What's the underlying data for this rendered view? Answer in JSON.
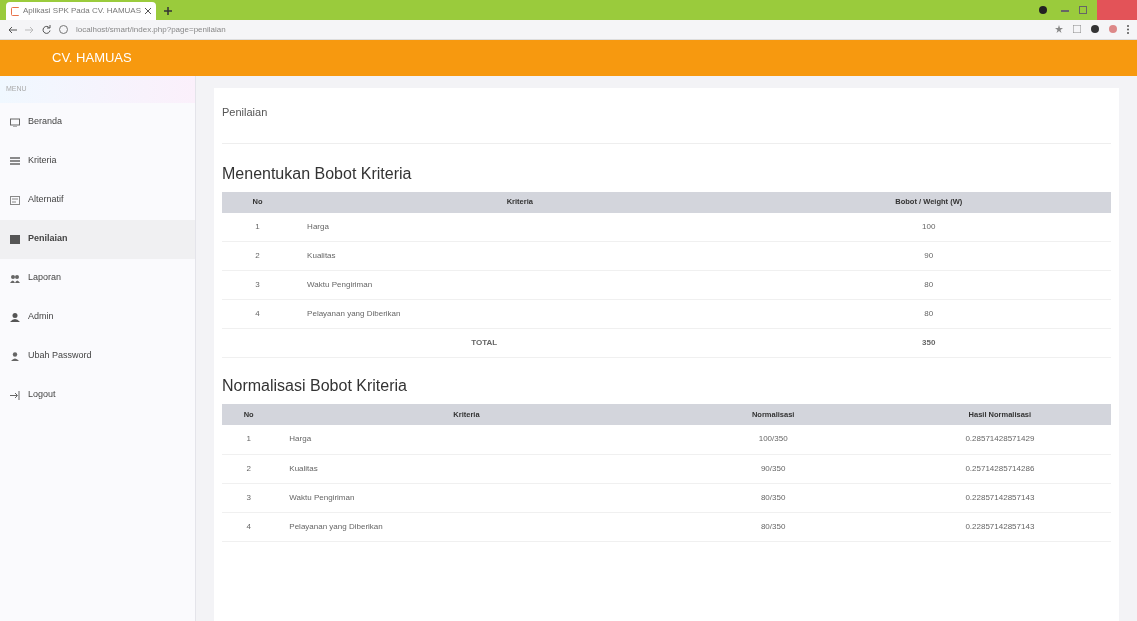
{
  "browser": {
    "tab_title": "Aplikasi SPK Pada CV. HAMUAS",
    "url": "localhost/smart/index.php?page=penilaian"
  },
  "header": {
    "brand": "CV. HAMUAS"
  },
  "sidebar": {
    "heading": "MENU",
    "items": [
      {
        "label": "Beranda",
        "selected": false
      },
      {
        "label": "Kriteria",
        "selected": false
      },
      {
        "label": "Alternatif",
        "selected": false
      },
      {
        "label": "Penilaian",
        "selected": true
      },
      {
        "label": "Laporan",
        "selected": false
      },
      {
        "label": "Admin",
        "selected": false
      },
      {
        "label": "Ubah Password",
        "selected": false
      },
      {
        "label": "Logout",
        "selected": false
      }
    ]
  },
  "page_title": "Penilaian",
  "weights": {
    "title": "Menentukan Bobot Kriteria",
    "columns": [
      "No",
      "Kriteria",
      "Bobot / Weight (W)"
    ],
    "rows": [
      [
        "1",
        "Harga",
        "100"
      ],
      [
        "2",
        "Kualitas",
        "90"
      ],
      [
        "3",
        "Waktu Pengiriman",
        "80"
      ],
      [
        "4",
        "Pelayanan yang Diberikan",
        "80"
      ]
    ],
    "total_label": "TOTAL",
    "total": "350"
  },
  "normalization": {
    "title": "Normalisasi Bobot Kriteria",
    "columns": [
      "No",
      "Kriteria",
      "Normalisasi",
      "Hasil Normalisasi"
    ],
    "rows": [
      [
        "1",
        "Harga",
        "100/350",
        "0.28571428571429"
      ],
      [
        "2",
        "Kualitas",
        "90/350",
        "0.25714285714286"
      ],
      [
        "3",
        "Waktu Pengiriman",
        "80/350",
        "0.22857142857143"
      ],
      [
        "4",
        "Pelayanan yang Diberikan",
        "80/350",
        "0.22857142857143"
      ]
    ]
  }
}
